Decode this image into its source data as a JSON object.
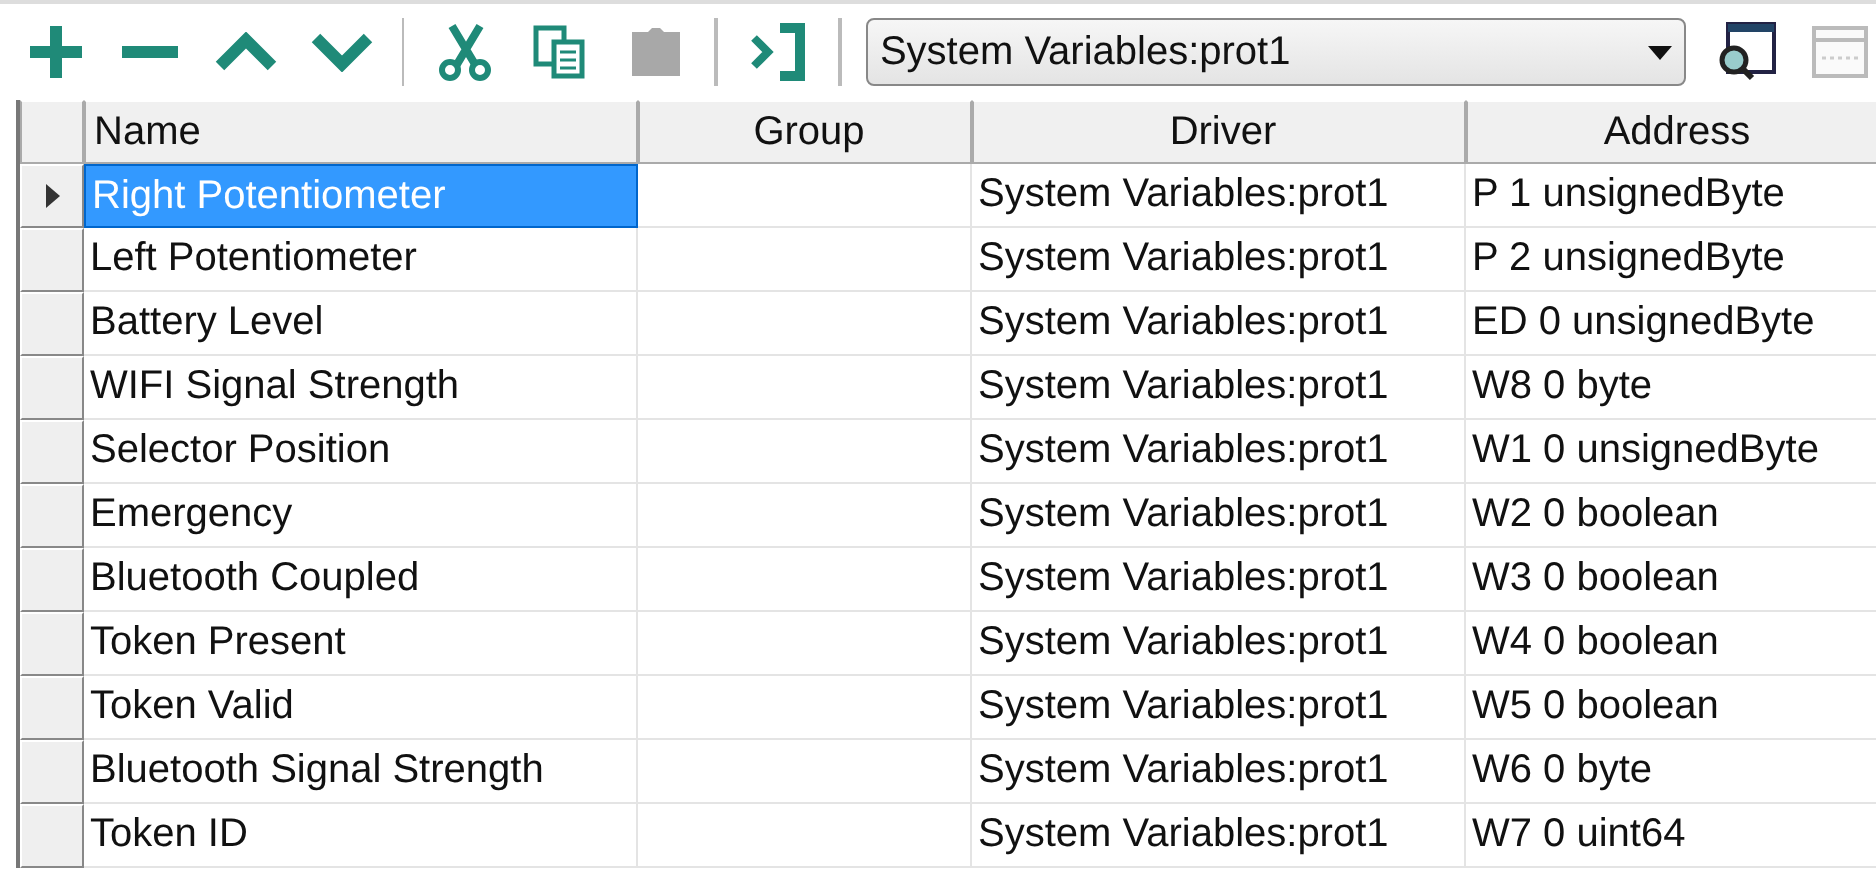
{
  "toolbar": {
    "driver_select": {
      "value": "System Variables:prot1"
    }
  },
  "table": {
    "columns": [
      "Name",
      "Group",
      "Driver",
      "Address"
    ],
    "rows": [
      {
        "name": "Right Potentiometer",
        "driver": "System Variables:prot1",
        "address": "P 1 unsignedByte",
        "selected": true
      },
      {
        "name": "Left Potentiometer",
        "driver": "System Variables:prot1",
        "address": "P 2 unsignedByte",
        "selected": false
      },
      {
        "name": "Battery Level",
        "driver": "System Variables:prot1",
        "address": "ED 0 unsignedByte",
        "selected": false
      },
      {
        "name": "WIFI Signal Strength",
        "driver": "System Variables:prot1",
        "address": "W8 0 byte",
        "selected": false
      },
      {
        "name": "Selector Position",
        "driver": "System Variables:prot1",
        "address": "W1 0 unsignedByte",
        "selected": false
      },
      {
        "name": "Emergency",
        "driver": "System Variables:prot1",
        "address": "W2 0 boolean",
        "selected": false
      },
      {
        "name": "Bluetooth Coupled",
        "driver": "System Variables:prot1",
        "address": "W3 0 boolean",
        "selected": false
      },
      {
        "name": "Token Present",
        "driver": "System Variables:prot1",
        "address": "W4 0 boolean",
        "selected": false
      },
      {
        "name": "Token Valid",
        "driver": "System Variables:prot1",
        "address": "W5 0 boolean",
        "selected": false
      },
      {
        "name": "Bluetooth Signal Strength",
        "driver": "System Variables:prot1",
        "address": "W6 0 byte",
        "selected": false
      },
      {
        "name": "Token ID",
        "driver": "System Variables:prot1",
        "address": "W7 0 uint64",
        "selected": false
      }
    ]
  }
}
